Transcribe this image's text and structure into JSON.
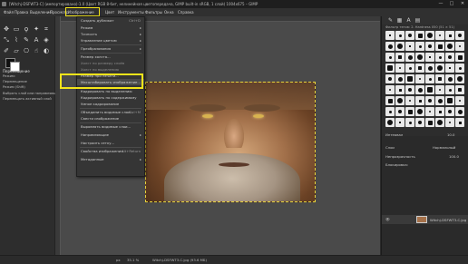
{
  "window": {
    "title": "[Witchj-DSFWT3-C] (импортировано)-1.0 (Цвет RGB 8-бит, нелинейная цветопередача, GIMP built-in sRGB, 1 слой) 1004x675 – GIMP"
  },
  "menubar": {
    "items": [
      "Файл",
      "Правка",
      "Выделение",
      "Просмотр",
      "Изображение",
      "Цвет",
      "Инструменты",
      "Фильтры",
      "Окна",
      "Справка"
    ]
  },
  "image_menu": {
    "items": [
      {
        "label": "Создать дубликат",
        "shortcut": "Ctrl+D",
        "submenu": false,
        "dim": false
      },
      {
        "label": "Режим",
        "shortcut": "",
        "submenu": true,
        "dim": false
      },
      {
        "label": "Точность",
        "shortcut": "",
        "submenu": true,
        "dim": false
      },
      {
        "label": "Управление цветом",
        "shortcut": "",
        "submenu": true,
        "dim": false
      },
      {
        "label": "Преобразования",
        "shortcut": "",
        "submenu": true,
        "dim": false
      },
      {
        "label": "Размер холста...",
        "shortcut": "",
        "submenu": false,
        "dim": false
      },
      {
        "label": "Холст по размеру слоёв",
        "shortcut": "",
        "submenu": false,
        "dim": true
      },
      {
        "label": "Холст по выделению",
        "shortcut": "",
        "submenu": false,
        "dim": true
      },
      {
        "label": "Размер при печати...",
        "shortcut": "",
        "submenu": false,
        "dim": false
      },
      {
        "label": "Масштабировать изображение...",
        "shortcut": "",
        "submenu": false,
        "dim": false
      },
      {
        "label": "Кадрировать по выделению",
        "shortcut": "",
        "submenu": false,
        "dim": false
      },
      {
        "label": "Кадрировать по содержимому",
        "shortcut": "",
        "submenu": false,
        "dim": false
      },
      {
        "label": "Умное кадрирование",
        "shortcut": "",
        "submenu": false,
        "dim": false
      },
      {
        "label": "Объединить видимые слои...",
        "shortcut": "Ctrl+M",
        "submenu": false,
        "dim": false
      },
      {
        "label": "Свести изображение",
        "shortcut": "",
        "submenu": false,
        "dim": false
      },
      {
        "label": "Выровнять видимые слои...",
        "shortcut": "",
        "submenu": false,
        "dim": false
      },
      {
        "label": "Направляющие",
        "shortcut": "",
        "submenu": true,
        "dim": false
      },
      {
        "label": "Настроить сетку...",
        "shortcut": "",
        "submenu": false,
        "dim": false
      },
      {
        "label": "Свойства изображения",
        "shortcut": "Alt+Return",
        "submenu": false,
        "dim": false
      },
      {
        "label": "Метаданные",
        "shortcut": "",
        "submenu": true,
        "dim": false
      }
    ]
  },
  "tool_options": {
    "title": "Перемещение",
    "mode_label": "Режим:",
    "rows": [
      "Перемещение",
      "Режим (Shift)",
      "Выбрать слой или направляющую",
      "Перемещать активный слой"
    ]
  },
  "right_panel": {
    "brush_title": "Фильтр тегов: 2. Hardness 050 (51 × 51)",
    "spacing_label": "Интервал",
    "spacing_value": "10.0",
    "layers_tab": "Слои",
    "layer_mode": "Нормальный",
    "opacity_label": "Непрозрачность",
    "opacity_value": "100.0",
    "lock_label": "Блокировка:",
    "layer_name": "Witchj-DSFWT3-C.jpg"
  },
  "statusbar": {
    "unit": "px",
    "zoom": "35.1 %",
    "file_info": "Witchj-DSFWT3-C.jpg (93.6 МБ)"
  },
  "colors": {
    "highlight": "#f3e41a",
    "background": "#2b2b2b"
  }
}
